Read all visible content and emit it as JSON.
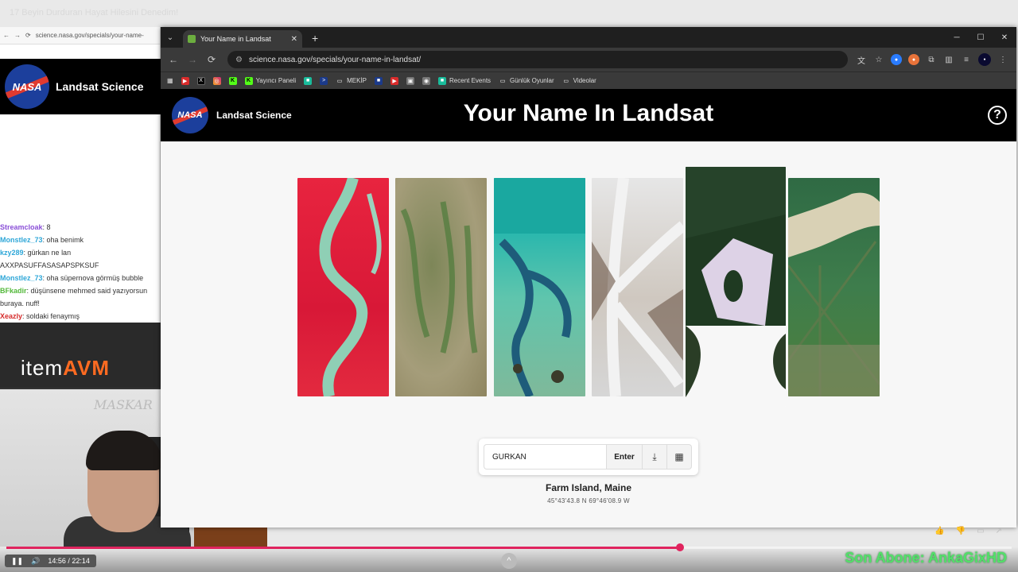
{
  "stream": {
    "title": "17 Beyin Durduran Hayat Hilesini Denedim!",
    "bg_url": "science.nasa.gov/specials/your-name-",
    "bg_site_name": "Landsat Science",
    "chat": [
      {
        "user": "Streamcloak",
        "text": ": 8",
        "color": "#8a4fd8"
      },
      {
        "user": "Monstlez_73",
        "text": ": oha benimk",
        "color": "#2fa7d8"
      },
      {
        "user": "kzy289",
        "text": ": gürkan ne lan AXXPASUFFASASAPSPKSUF",
        "color": "#2fa7d8"
      },
      {
        "user": "Monstlez_73",
        "text": ": oha süpernova görmüş bubble",
        "color": "#2fa7d8"
      },
      {
        "user": "BFkadir",
        "text": ": düşünsene mehmed said yazıyorsun buraya. nuff!",
        "color": "#53b83a"
      },
      {
        "user": "Xeazly",
        "text": ": soldaki fenaymış",
        "color": "#d62c2c"
      }
    ],
    "promo_brand_a": "item",
    "promo_brand_b": "AVM",
    "webcam_sign": "MASKAR",
    "video_time": "14:56 / 22:14",
    "video_progress": 0.67,
    "sub_overlay": "Son Abone: AnkaGixHD",
    "chevron": "^"
  },
  "browser": {
    "tab_title": "Your Name in Landsat",
    "url": "science.nasa.gov/specials/your-name-in-landsat/",
    "bookmarks": [
      {
        "label": "",
        "icon": "youtube-icon",
        "cls": "b-red",
        "glyph": "▶"
      },
      {
        "label": "",
        "icon": "x-icon",
        "cls": "b-x",
        "glyph": "X"
      },
      {
        "label": "",
        "icon": "instagram-icon",
        "cls": "b-ig",
        "glyph": "◎"
      },
      {
        "label": "",
        "icon": "kick-icon",
        "cls": "b-k",
        "glyph": "K"
      },
      {
        "label": "Yayıncı Paneli",
        "icon": "kick-icon",
        "cls": "b-k",
        "glyph": "K"
      },
      {
        "label": "",
        "icon": "app-icon",
        "cls": "b-teal",
        "glyph": "■"
      },
      {
        "label": "",
        "icon": "prompt-icon",
        "cls": "b-blue",
        "glyph": ">"
      },
      {
        "label": "MEKİP",
        "icon": "folder-icon",
        "cls": "b-folder",
        "glyph": "▭"
      },
      {
        "label": "",
        "icon": "app-icon",
        "cls": "b-blue",
        "glyph": "■"
      },
      {
        "label": "",
        "icon": "youtube-icon",
        "cls": "b-red",
        "glyph": "▶"
      },
      {
        "label": "",
        "icon": "image-icon",
        "cls": "b-gray",
        "glyph": "▣"
      },
      {
        "label": "",
        "icon": "globe-icon",
        "cls": "b-gray",
        "glyph": "◉"
      },
      {
        "label": "Recent Events",
        "icon": "app-icon",
        "cls": "b-teal",
        "glyph": "■"
      },
      {
        "label": "Günlük Oyunlar",
        "icon": "folder-icon",
        "cls": "b-folder",
        "glyph": "▭"
      },
      {
        "label": "Videolar",
        "icon": "folder-icon",
        "cls": "b-folder",
        "glyph": "▭"
      }
    ]
  },
  "site": {
    "logo_text": "NASA",
    "brand": "Landsat Science",
    "title": "Your Name In Landsat",
    "help": "?"
  },
  "letters": [
    {
      "letter": "G",
      "color": "#e3223c"
    },
    {
      "letter": "U",
      "color": "#8a8a66"
    },
    {
      "letter": "R",
      "color": "#2ab7ad"
    },
    {
      "letter": "K",
      "color": "#d8d8d8"
    },
    {
      "letter": "A",
      "color": "#1f3a22"
    },
    {
      "letter": "N",
      "color": "#3e7d4c"
    }
  ],
  "form": {
    "name_value": "GURKAN",
    "enter_label": "Enter"
  },
  "location": {
    "name": "Farm Island, Maine",
    "coords": "45°43'43.8 N 69°46'08.9 W"
  }
}
